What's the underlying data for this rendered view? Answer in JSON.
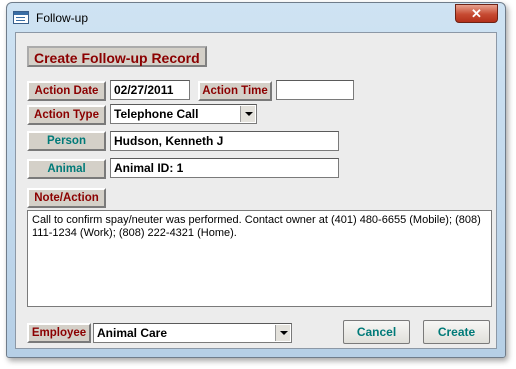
{
  "window": {
    "title": "Follow-up",
    "close_label": "✕"
  },
  "form": {
    "heading": "Create Follow-up Record",
    "action_date": {
      "label": "Action Date",
      "value": "02/27/2011"
    },
    "action_time": {
      "label": "Action Time",
      "value": ""
    },
    "action_type": {
      "label": "Action Type",
      "value": "Telephone Call"
    },
    "person": {
      "label": "Person",
      "value": "Hudson, Kenneth J"
    },
    "animal": {
      "label": "Animal",
      "value": "Animal ID: 1"
    },
    "note": {
      "label": "Note/Action",
      "value": "Call to confirm spay/neuter was performed. Contact owner at (401) 480-6655 (Mobile); (808) 111-1234 (Work); (808) 222-4321 (Home)."
    },
    "employee": {
      "label": "Employee",
      "value": "Animal Care"
    },
    "cancel_label": "Cancel",
    "create_label": "Create"
  },
  "colors": {
    "label_red": "#8b0000",
    "label_teal": "#007a78",
    "form_background": "#ececec"
  },
  "icons": {
    "app": "form-window-icon",
    "close": "close-icon",
    "dropdown": "chevron-down-icon"
  }
}
